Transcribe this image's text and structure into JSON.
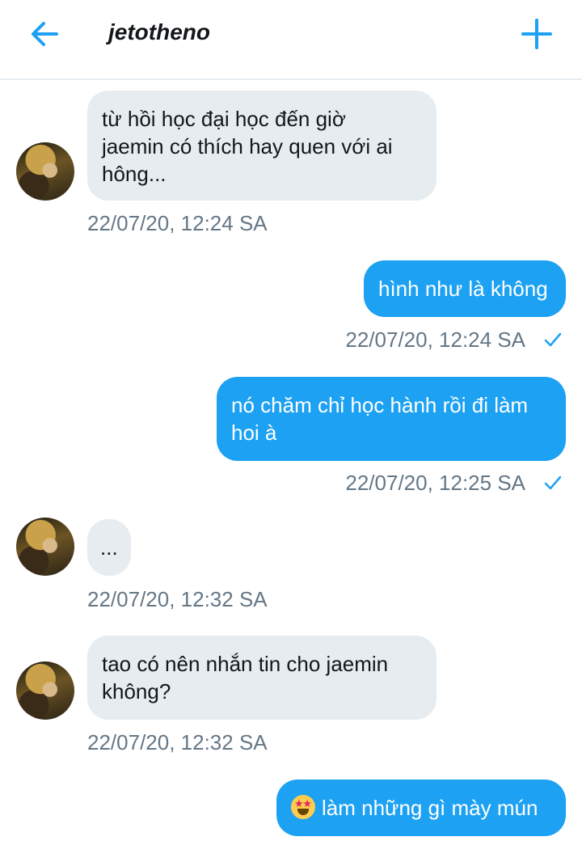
{
  "header": {
    "title": "jetotheno",
    "back_icon": "arrow-left-icon",
    "add_icon": "plus-icon",
    "accent": "#1da1f2"
  },
  "messages": [
    {
      "from": "them",
      "text": "từ hồi học đại học đến giờ\njaemin có thích hay quen với ai\nhông...",
      "time": "22/07/20, 12:24 SA"
    },
    {
      "from": "me",
      "text": "hình như là không",
      "time": "22/07/20, 12:24 SA",
      "status_icon": "check-icon"
    },
    {
      "from": "me",
      "text": "nó chăm chỉ học hành rồi đi làm\nhoi à",
      "time": "22/07/20, 12:25 SA",
      "status_icon": "check-icon"
    },
    {
      "from": "them",
      "text": "...",
      "time": "22/07/20, 12:32 SA"
    },
    {
      "from": "them",
      "text": "tao có nên nhắn tin cho jaemin\nkhông?",
      "time": "22/07/20, 12:32 SA"
    },
    {
      "from": "me",
      "text": "làm những gì mày mún",
      "emoji": "star-struck-emoji"
    }
  ],
  "colors": {
    "incoming_bubble": "#e6ecf0",
    "outgoing_bubble": "#1da1f2",
    "timestamp": "#657786"
  }
}
